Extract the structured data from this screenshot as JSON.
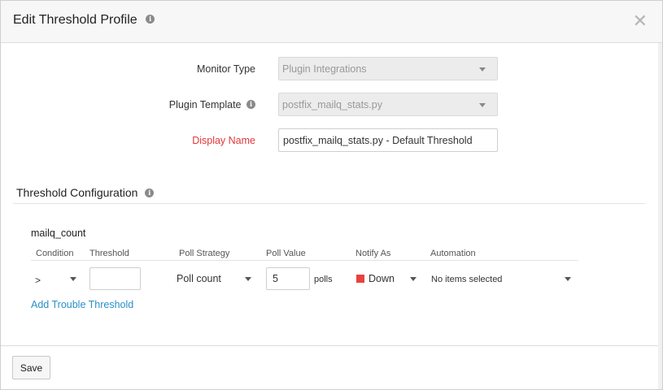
{
  "modal": {
    "title": "Edit Threshold Profile"
  },
  "form": {
    "monitor_type": {
      "label": "Monitor Type",
      "value": "Plugin Integrations"
    },
    "plugin_template": {
      "label": "Plugin Template",
      "value": "postfix_mailq_stats.py"
    },
    "display_name": {
      "label": "Display Name",
      "value": "postfix_mailq_stats.py - Default Threshold"
    }
  },
  "threshold_config": {
    "title": "Threshold Configuration",
    "metric": "mailq_count",
    "columns": [
      "Condition",
      "Threshold",
      "Poll Strategy",
      "Poll Value",
      "Notify As",
      "Automation"
    ],
    "row": {
      "condition": ">",
      "threshold": "",
      "poll_strategy": "Poll count",
      "poll_value": "5",
      "poll_unit": "polls",
      "notify_as": "Down",
      "notify_color": "#e8423f",
      "automation": "No items selected"
    },
    "add_link": "Add Trouble Threshold"
  },
  "footer": {
    "save_label": "Save"
  },
  "colors": {
    "required": "#e2383c",
    "link": "#2a8fc8",
    "header_bg": "#f7f7f7"
  }
}
